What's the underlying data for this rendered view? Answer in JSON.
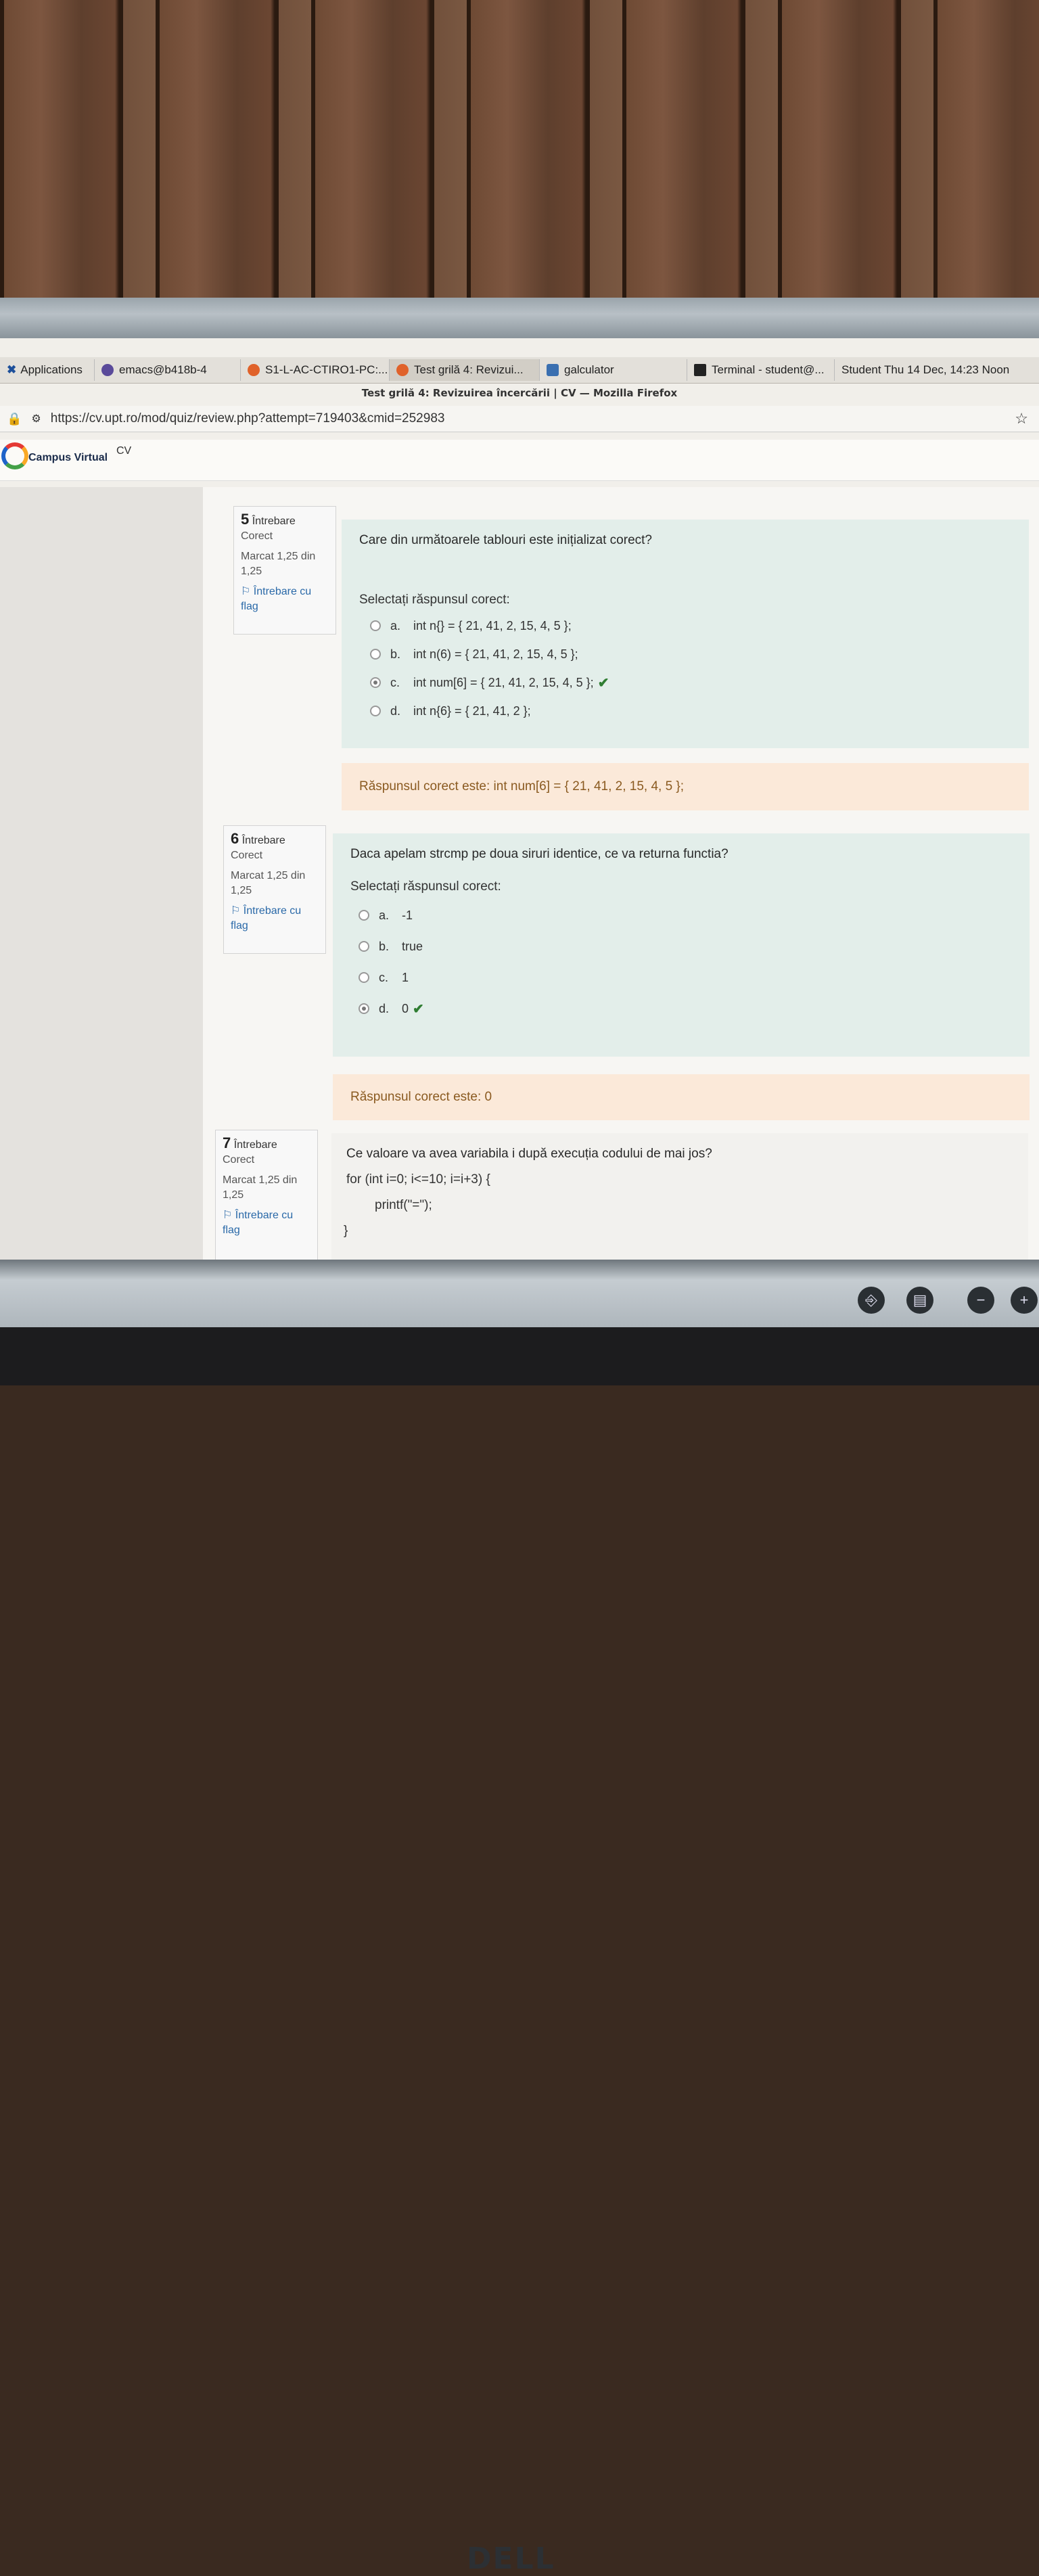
{
  "panel": {
    "tasks": [
      {
        "label": "Applications",
        "icon": "x-icon"
      },
      {
        "label": "emacs@b418b-4",
        "icon": "emacs-icon"
      },
      {
        "label": "S1-L-AC-CTIRO1-PC:...",
        "icon": "firefox-icon"
      },
      {
        "label": "Test grilă 4: Revizui...",
        "icon": "firefox-icon"
      },
      {
        "label": "galculator",
        "icon": "calculator-icon"
      },
      {
        "label": "Terminal - student@...",
        "icon": "terminal-icon"
      }
    ],
    "status": "Student Thu 14 Dec, 14:23 Noon"
  },
  "window_title": "Test grilă 4: Revizuirea încercării | CV — Mozilla Firefox",
  "url": "https://cv.upt.ro/mod/quiz/review.php?attempt=719403&cmid=252983",
  "site": {
    "name": "Campus Virtual",
    "badge": "CV"
  },
  "questions": [
    {
      "number": "5",
      "word": "Întrebare",
      "state": "Corect",
      "mark": "Marcat 1,25 din 1,25",
      "flag": "Întrebare cu flag",
      "text": "Care din următoarele tablouri este inițializat corect?",
      "prompt": "Selectați răspunsul corect:",
      "answers": [
        {
          "letter": "a.",
          "text": "int n{} = { 21, 41, 2, 15, 4, 5 };",
          "checked": false
        },
        {
          "letter": "b.",
          "text": "int n(6) = { 21, 41, 2, 15, 4, 5 };",
          "checked": false
        },
        {
          "letter": "c.",
          "text": "int num[6] = { 21, 41, 2, 15, 4, 5 };",
          "checked": true
        },
        {
          "letter": "d.",
          "text": "int n{6} = { 21, 41, 2 };",
          "checked": false
        }
      ],
      "feedback": "Răspunsul corect este: int num[6] = { 21, 41, 2, 15, 4, 5 };"
    },
    {
      "number": "6",
      "word": "Întrebare",
      "state": "Corect",
      "mark": "Marcat 1,25 din 1,25",
      "flag": "Întrebare cu flag",
      "text": "Daca apelam strcmp pe doua siruri identice, ce va returna functia?",
      "prompt": "Selectați răspunsul corect:",
      "answers": [
        {
          "letter": "a.",
          "text": "-1",
          "checked": false
        },
        {
          "letter": "b.",
          "text": "true",
          "checked": false
        },
        {
          "letter": "c.",
          "text": "1",
          "checked": false
        },
        {
          "letter": "d.",
          "text": "0",
          "checked": true
        }
      ],
      "feedback": "Răspunsul corect este: 0"
    },
    {
      "number": "7",
      "word": "Întrebare",
      "state": "Corect",
      "mark": "Marcat 1,25 din 1,25",
      "flag": "Întrebare cu flag",
      "text": "Ce valoare va avea variabila i după execuția codului de mai jos?",
      "code": [
        "for (int i=0;  i<=10; i=i+3) {",
        "printf(\"=\");",
        "}"
      ]
    }
  ],
  "monitor": {
    "brand": "DELL"
  }
}
